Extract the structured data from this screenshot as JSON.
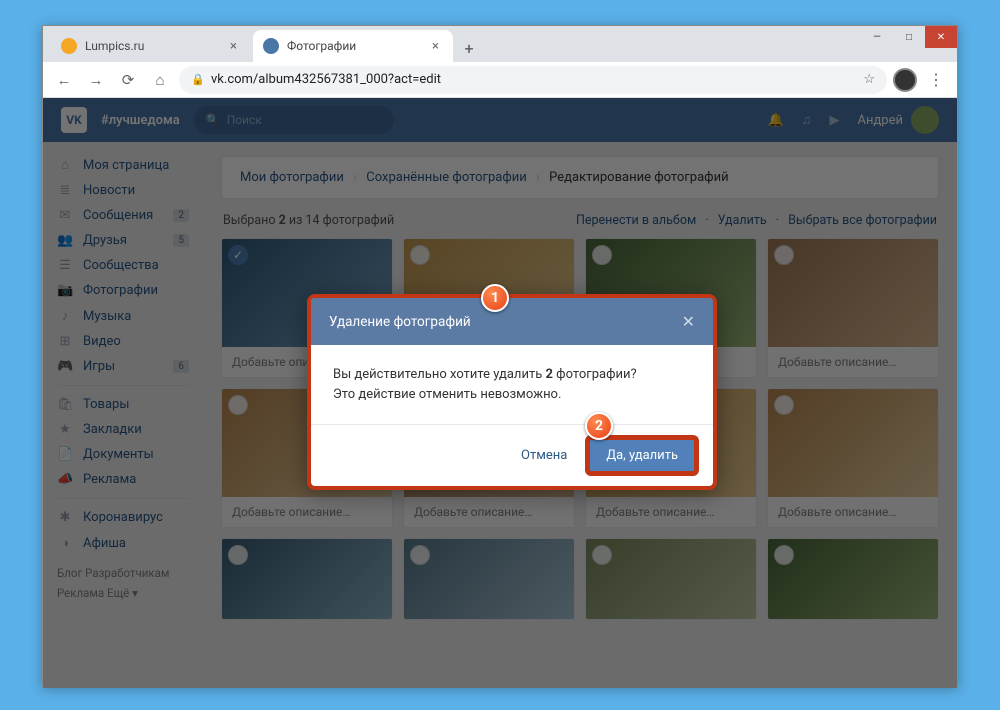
{
  "window": {
    "min": "—",
    "max": "□",
    "close": "✕"
  },
  "tabs": [
    {
      "title": "Lumpics.ru",
      "favicon_bg": "#f5a623"
    },
    {
      "title": "Фотографии",
      "favicon_bg": "#4a76a8"
    }
  ],
  "tab_new": "+",
  "nav": {
    "back": "←",
    "fwd": "→",
    "reload": "⟳",
    "home": "⌂"
  },
  "url": "vk.com/album432567381_000?act=edit",
  "star": "☆",
  "menu": "⋮",
  "vk": {
    "logo": "VK",
    "tag": "#лучшедома",
    "search_placeholder": "Поиск",
    "icons": {
      "bell": "🔔",
      "music": "♫",
      "play": "▶"
    },
    "user": "Андрей"
  },
  "sidebar": {
    "items": [
      {
        "icon": "⌂",
        "label": "Моя страница"
      },
      {
        "icon": "≣",
        "label": "Новости"
      },
      {
        "icon": "✉",
        "label": "Сообщения",
        "badge": "2"
      },
      {
        "icon": "👥",
        "label": "Друзья",
        "badge": "5"
      },
      {
        "icon": "☰",
        "label": "Сообщества"
      },
      {
        "icon": "📷",
        "label": "Фотографии"
      },
      {
        "icon": "♪",
        "label": "Музыка"
      },
      {
        "icon": "⊞",
        "label": "Видео"
      },
      {
        "icon": "🎮",
        "label": "Игры",
        "badge": "6"
      }
    ],
    "items2": [
      {
        "icon": "🛍",
        "label": "Товары"
      },
      {
        "icon": "★",
        "label": "Закладки"
      },
      {
        "icon": "📄",
        "label": "Документы"
      },
      {
        "icon": "📣",
        "label": "Реклама"
      }
    ],
    "items3": [
      {
        "icon": "✱",
        "label": "Коронавирус"
      },
      {
        "icon": "◑",
        "label": "Афиша"
      }
    ],
    "footer1": "Блог   Разработчикам",
    "footer2": "Реклама   Ещё ▾"
  },
  "breadcrumbs": {
    "a": "Мои фотографии",
    "b": "Сохранённые фотографии",
    "c": "Редактирование фотографий",
    "sep": "›"
  },
  "selection": {
    "text_pre": "Выбрано ",
    "count": "2",
    "text_post": " из 14 фотографий",
    "move": "Перенести в альбом",
    "del": "Удалить",
    "all": "Выбрать все фотографии",
    "dot": "·"
  },
  "caption": "Добавьте описание…",
  "modal": {
    "title": "Удаление фотографий",
    "close": "✕",
    "line1_pre": "Вы действительно хотите удалить ",
    "line1_bold": "2",
    "line1_post": " фотографии?",
    "line2": "Это действие отменить невозможно.",
    "cancel": "Отмена",
    "confirm": "Да, удалить"
  },
  "pins": {
    "p1": "1",
    "p2": "2"
  }
}
